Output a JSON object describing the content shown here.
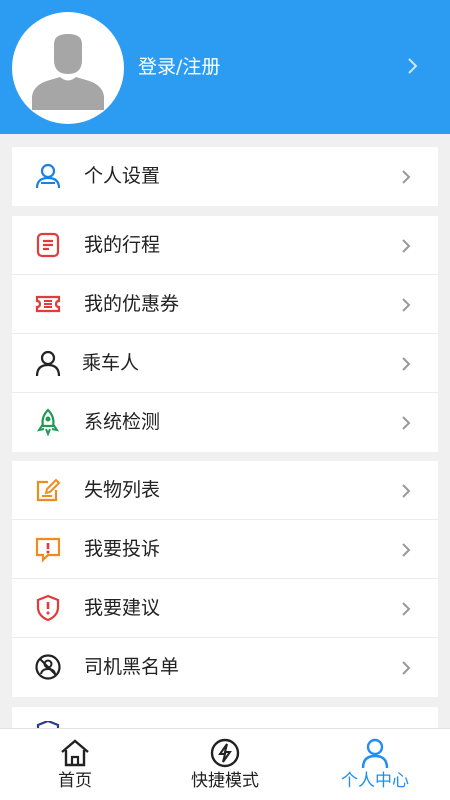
{
  "header": {
    "login_label": "登录/注册",
    "icons": {
      "avatar": "default-user-avatar",
      "chevron": "chevron-right-icon"
    }
  },
  "colors": {
    "header_bg": "#2b9cf2",
    "accent": "#1f8ef0"
  },
  "groups": [
    {
      "items": [
        {
          "label": "个人设置",
          "icon": "user-settings-icon"
        }
      ]
    },
    {
      "items": [
        {
          "label": "我的行程",
          "icon": "trip-list-icon"
        },
        {
          "label": "我的优惠券",
          "icon": "coupon-icon"
        },
        {
          "label": "乘车人",
          "icon": "person-icon"
        },
        {
          "label": "系统检测",
          "icon": "rocket-icon"
        }
      ]
    },
    {
      "items": [
        {
          "label": "失物列表",
          "icon": "edit-note-icon"
        },
        {
          "label": "我要投诉",
          "icon": "complaint-icon"
        },
        {
          "label": "我要建议",
          "icon": "shield-alert-icon"
        },
        {
          "label": "司机黑名单",
          "icon": "blocked-driver-icon"
        }
      ]
    }
  ],
  "tabs": [
    {
      "label": "首页",
      "icon": "home-icon"
    },
    {
      "label": "快捷模式",
      "icon": "lightning-icon"
    },
    {
      "label": "个人中心",
      "icon": "user-icon",
      "active": true
    }
  ]
}
